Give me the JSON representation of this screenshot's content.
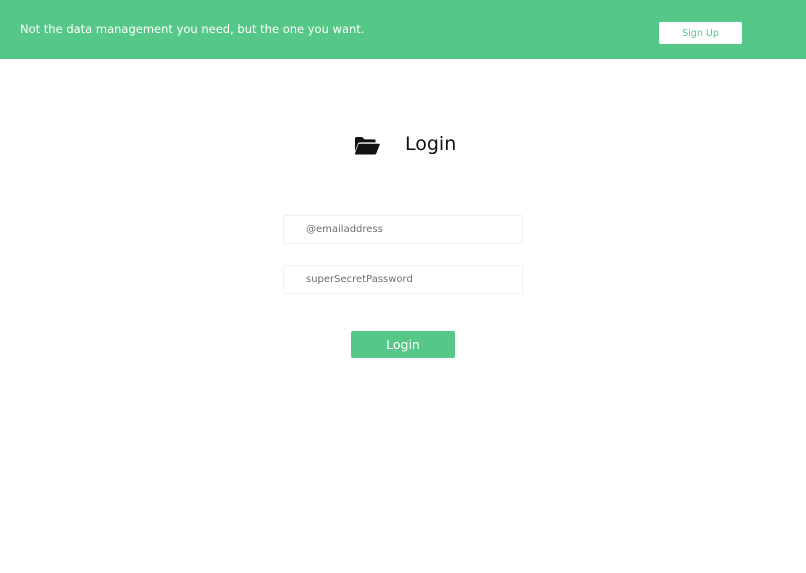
{
  "header": {
    "tagline": "Not the data management you need, but the one you want.",
    "signup_label": "Sign Up",
    "background_color": "#55c787"
  },
  "login": {
    "icon": "folder-open-icon",
    "title": "Login",
    "email_placeholder": "@emailaddress",
    "password_placeholder": "superSecretPassword",
    "submit_label": "Login",
    "accent_color": "#55c787"
  }
}
